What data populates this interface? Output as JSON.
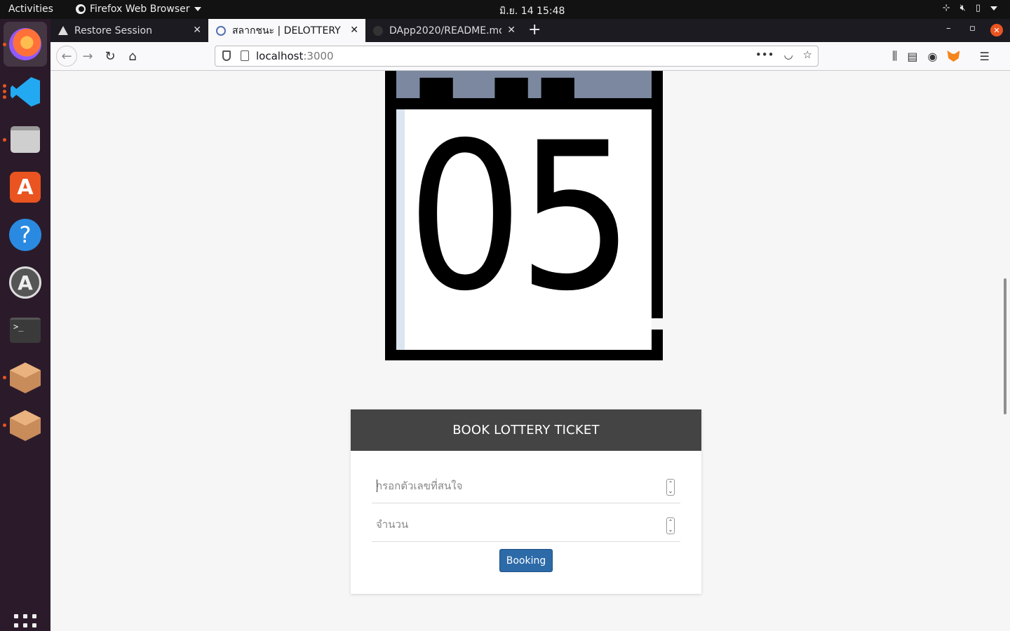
{
  "system": {
    "activities": "Activities",
    "app_name": "Firefox Web Browser",
    "clock": "มิ.ย. 14  15:48"
  },
  "browser": {
    "tabs": [
      {
        "title": "Restore Session",
        "icon": "warning-icon",
        "selected": false
      },
      {
        "title": "สลากชนะ | DELOTTERY",
        "icon": "lottery-favicon",
        "selected": true
      },
      {
        "title": "DApp2020/README.md",
        "icon": "github-icon",
        "selected": false
      }
    ],
    "url_host": "localhost",
    "url_port": ":3000"
  },
  "calendar": {
    "day": "05",
    "header_color": "#7b889f"
  },
  "booking_form": {
    "title": "BOOK LOTTERY TICKET",
    "number_placeholder": "กรอกตัวเลขที่สนใจ",
    "amount_placeholder": "จำนวน",
    "submit_label": "Booking",
    "button_color": "#2c6aa8"
  },
  "theme": {
    "accent": "#e95420",
    "dock_bg": "#2b1b2a"
  }
}
